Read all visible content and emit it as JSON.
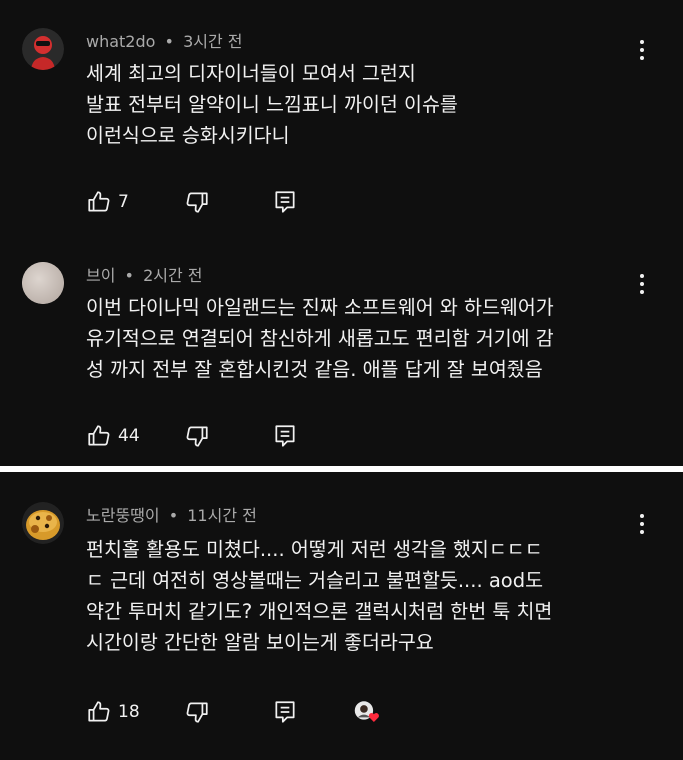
{
  "comments": [
    {
      "author": "what2do",
      "time": "3시간 전",
      "lines": [
        "세계 최고의 디자이너들이 모여서 그런지",
        "발표 전부터 알약이니 느낌표니 까이던 이슈를",
        "이런식으로 승화시키다니"
      ],
      "likes": "7"
    },
    {
      "author": "브이",
      "time": "2시간 전",
      "lines": [
        "이번 다이나믹 아일랜드는 진짜 소프트웨어 와 하드웨어가",
        "유기적으로 연결되어 참신하게 새롭고도 편리함 거기에 감",
        "성 까지 전부 잘 혼합시킨것 같음. 애플 답게 잘 보여줬음"
      ],
      "likes": "44"
    },
    {
      "author": "노란뚱땡이",
      "time": "11시간 전",
      "lines": [
        "펀치홀 활용도 미쳤다.... 어떻게 저런 생각을 했지ㄷㄷㄷ",
        "ㄷ 근데 여전히 영상볼때는 거슬리고 불편할듯.... aod도",
        "약간 투머치 같기도? 개인적으론 갤럭시처럼 한번 툭 치면",
        "시간이랑 간단한 알람 보이는게 좋더라구요"
      ],
      "likes": "18",
      "creator_heart": true
    }
  ],
  "separator": "•",
  "icons": {
    "like": "thumbs-up-icon",
    "dislike": "thumbs-down-icon",
    "reply": "reply-icon",
    "more": "more-vert-icon",
    "heart": "creator-heart-icon"
  },
  "colors": {
    "background": "#0f0f0f",
    "text": "#f1f1f1",
    "meta": "#aaaaaa",
    "heart": "#ff2a3d"
  }
}
